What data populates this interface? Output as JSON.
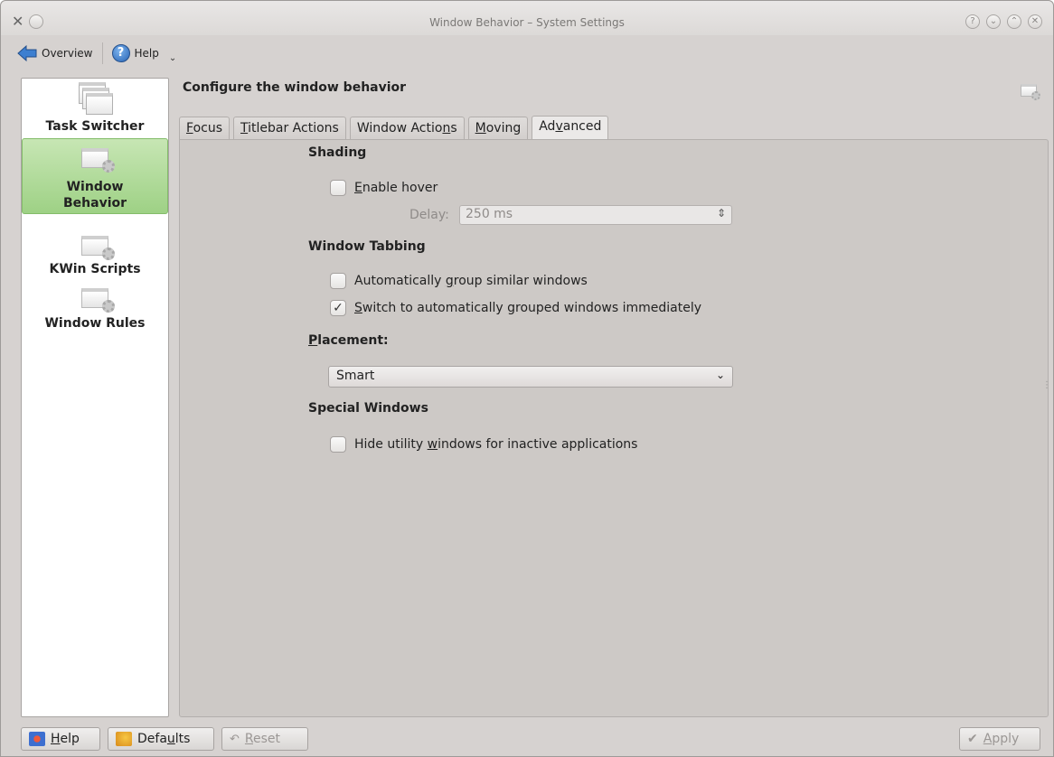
{
  "window": {
    "title": "Window Behavior – System Settings",
    "controls": [
      "?",
      "⌄",
      "⌃",
      "✕"
    ]
  },
  "toolbar": {
    "overview_label": "Overview",
    "help_label": "Help"
  },
  "sidebar": {
    "items": [
      {
        "label": "Task Switcher",
        "icon": "task-switcher-icon"
      },
      {
        "label_1": "Window",
        "label_2": "Behavior",
        "icon": "window-behavior-icon",
        "active": true
      },
      {
        "label": "KWin Scripts",
        "icon": "kwin-scripts-icon"
      },
      {
        "label": "Window Rules",
        "icon": "window-rules-icon"
      }
    ]
  },
  "header": {
    "title": "Configure the window behavior"
  },
  "tabs": [
    {
      "pre": "",
      "ul": "F",
      "post": "ocus"
    },
    {
      "pre": "",
      "ul": "T",
      "post": "itlebar Actions"
    },
    {
      "pre": "Window Actio",
      "ul": "n",
      "post": "s"
    },
    {
      "pre": "",
      "ul": "M",
      "post": "oving"
    },
    {
      "pre": "Ad",
      "ul": "v",
      "post": "anced",
      "active": true
    }
  ],
  "sections": {
    "shading": {
      "title": "Shading",
      "enable_hover_ul": "E",
      "enable_hover_rest": "nable hover",
      "enable_hover_checked": false,
      "delay_label": "Delay:",
      "delay_value": "250 ms"
    },
    "tabbing": {
      "title": "Window Tabbing",
      "auto_group_pre": "Automatically ",
      "auto_group_ul": "g",
      "auto_group_post": "roup similar windows",
      "auto_group_checked": false,
      "switch_ul": "S",
      "switch_rest": "witch to automatically grouped windows immediately",
      "switch_checked": true
    },
    "placement": {
      "title_ul": "P",
      "title_rest": "lacement:",
      "value": "Smart"
    },
    "special": {
      "title": "Special Windows",
      "hide_pre": "Hide utility ",
      "hide_ul": "w",
      "hide_post": "indows for inactive applications",
      "hide_checked": false
    }
  },
  "bottom": {
    "help_ul": "H",
    "help_rest": "elp",
    "defaults_pre": "Defa",
    "defaults_ul": "u",
    "defaults_post": "lts",
    "reset_ul": "R",
    "reset_rest": "eset",
    "apply_ul": "A",
    "apply_rest": "pply"
  },
  "colors": {
    "active_sidebar": "#a8d68e",
    "panel_bg": "#cdc9c6",
    "window_bg": "#d6d2d0"
  }
}
